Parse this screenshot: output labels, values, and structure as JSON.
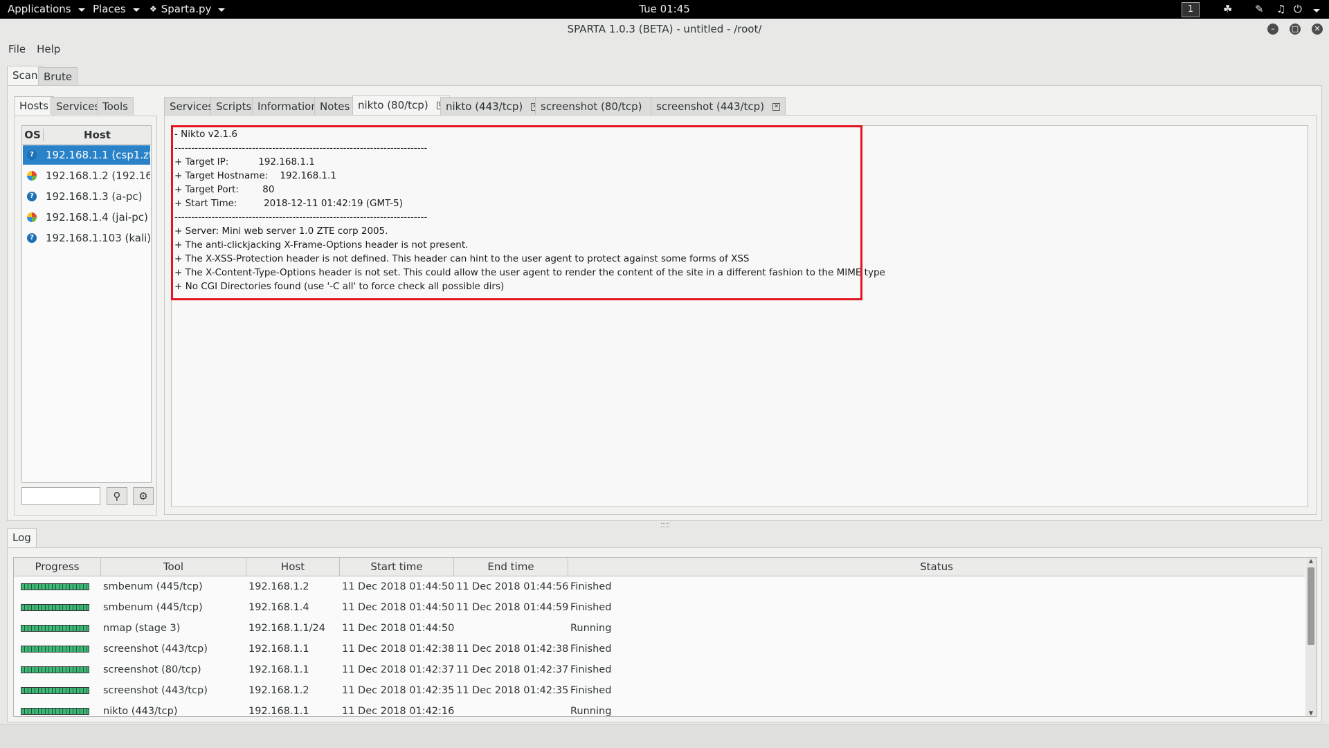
{
  "topbar": {
    "applications": "Applications",
    "places": "Places",
    "app_menu": "Sparta.py",
    "clock": "Tue 01:45",
    "workspace": "1"
  },
  "window": {
    "title": "SPARTA 1.0.3 (BETA) - untitled - /root/"
  },
  "menubar": {
    "file": "File",
    "help": "Help"
  },
  "main_tabs": [
    "Scan",
    "Brute"
  ],
  "left_tabs": [
    "Hosts",
    "Services",
    "Tools"
  ],
  "host_table": {
    "col_os": "OS",
    "col_host": "Host",
    "rows": [
      {
        "label": "192.168.1.1 (csp1.zt...",
        "os": "unknown"
      },
      {
        "label": "192.168.1.2 (192.16...",
        "os": "windows"
      },
      {
        "label": "192.168.1.3 (a-pc)",
        "os": "unknown"
      },
      {
        "label": "192.168.1.4 (jai-pc)",
        "os": "windows"
      },
      {
        "label": "192.168.1.103 (kali)",
        "os": "unknown"
      }
    ]
  },
  "right_tabs": [
    {
      "label": "Services",
      "closable": false
    },
    {
      "label": "Scripts",
      "closable": false
    },
    {
      "label": "Information",
      "closable": false
    },
    {
      "label": "Notes",
      "closable": false
    },
    {
      "label": "nikto (80/tcp)",
      "closable": true,
      "active": true
    },
    {
      "label": "nikto (443/tcp)",
      "closable": true
    },
    {
      "label": "screenshot (80/tcp)",
      "closable": true
    },
    {
      "label": "screenshot (443/tcp)",
      "closable": true
    }
  ],
  "nikto_output": [
    "- Nikto v2.1.6",
    "---------------------------------------------------------------------------",
    "+ Target IP:          192.168.1.1",
    "+ Target Hostname:    192.168.1.1",
    "+ Target Port:        80",
    "+ Start Time:         2018-12-11 01:42:19 (GMT-5)",
    "---------------------------------------------------------------------------",
    "+ Server: Mini web server 1.0 ZTE corp 2005.",
    "+ The anti-clickjacking X-Frame-Options header is not present.",
    "+ The X-XSS-Protection header is not defined. This header can hint to the user agent to protect against some forms of XSS",
    "+ The X-Content-Type-Options header is not set. This could allow the user agent to render the content of the site in a different fashion to the MIME type",
    "+ No CGI Directories found (use '-C all' to force check all possible dirs)"
  ],
  "log_tab": "Log",
  "log_table": {
    "headers": [
      "Progress",
      "Tool",
      "Host",
      "Start time",
      "End time",
      "Status"
    ],
    "rows": [
      {
        "progress": 100,
        "tool": "smbenum (445/tcp)",
        "host": "192.168.1.2",
        "start": "11 Dec 2018 01:44:50",
        "end": "11 Dec 2018 01:44:56",
        "status": "Finished"
      },
      {
        "progress": 100,
        "tool": "smbenum (445/tcp)",
        "host": "192.168.1.4",
        "start": "11 Dec 2018 01:44:50",
        "end": "11 Dec 2018 01:44:59",
        "status": "Finished"
      },
      {
        "progress": 100,
        "tool": "nmap (stage 3)",
        "host": "192.168.1.1/24",
        "start": "11 Dec 2018 01:44:50",
        "end": "",
        "status": "Running"
      },
      {
        "progress": 100,
        "tool": "screenshot (443/tcp)",
        "host": "192.168.1.1",
        "start": "11 Dec 2018 01:42:38",
        "end": "11 Dec 2018 01:42:38",
        "status": "Finished"
      },
      {
        "progress": 100,
        "tool": "screenshot (80/tcp)",
        "host": "192.168.1.1",
        "start": "11 Dec 2018 01:42:37",
        "end": "11 Dec 2018 01:42:37",
        "status": "Finished"
      },
      {
        "progress": 100,
        "tool": "screenshot (443/tcp)",
        "host": "192.168.1.2",
        "start": "11 Dec 2018 01:42:35",
        "end": "11 Dec 2018 01:42:35",
        "status": "Finished"
      },
      {
        "progress": 100,
        "tool": "nikto (443/tcp)",
        "host": "192.168.1.1",
        "start": "11 Dec 2018 01:42:16",
        "end": "",
        "status": "Running"
      }
    ]
  },
  "icons": {
    "search": "search-icon",
    "hosts_filter": "filter-icon",
    "os_unknown": "question-icon",
    "os_windows": "windows-icon"
  },
  "colors": {
    "selection": "#2a82c8",
    "highlight_box": "#e3141f",
    "progress": "#3fb877"
  }
}
